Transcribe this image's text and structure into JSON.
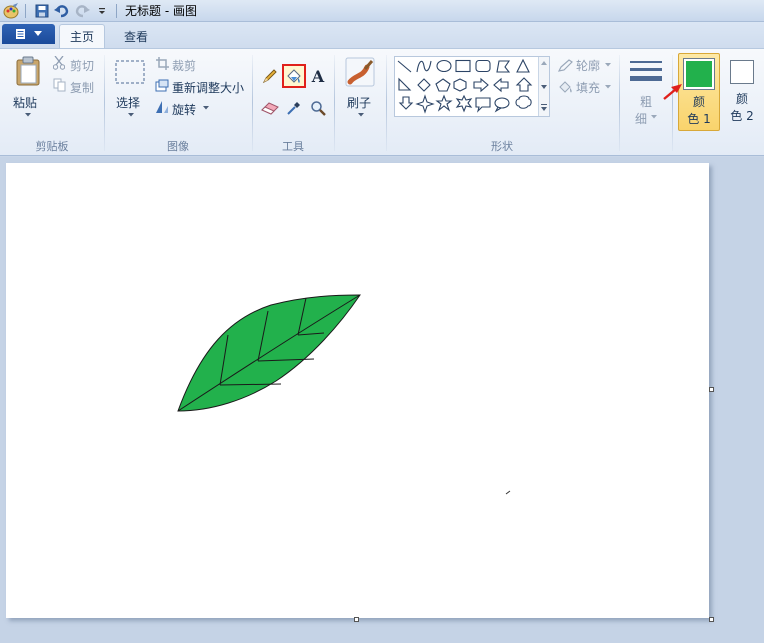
{
  "window": {
    "title": "无标题 - 画图"
  },
  "tabs": [
    {
      "label": "主页",
      "active": true
    },
    {
      "label": "查看",
      "active": false
    }
  ],
  "clipboard": {
    "paste_label": "粘贴",
    "cut_label": "剪切",
    "copy_label": "复制",
    "group_label": "剪贴板"
  },
  "image": {
    "select_label": "选择",
    "crop_label": "裁剪",
    "resize_label": "重新调整大小",
    "rotate_label": "旋转",
    "group_label": "图像"
  },
  "tools": {
    "group_label": "工具"
  },
  "brushes": {
    "label": "刷子"
  },
  "shapes": {
    "outline_label": "轮廓",
    "fill_label": "填充",
    "group_label": "形状"
  },
  "size": {
    "label_line1": "粗",
    "label_line2": "细"
  },
  "colors": {
    "color1_line1": "颜",
    "color1_line2": "色 1",
    "color2_line1": "颜",
    "color2_line2": "色 2",
    "color1_value": "#22b14c",
    "color2_value": "#ffffff"
  },
  "canvas": {
    "leaf_fill": "#22b14c"
  }
}
